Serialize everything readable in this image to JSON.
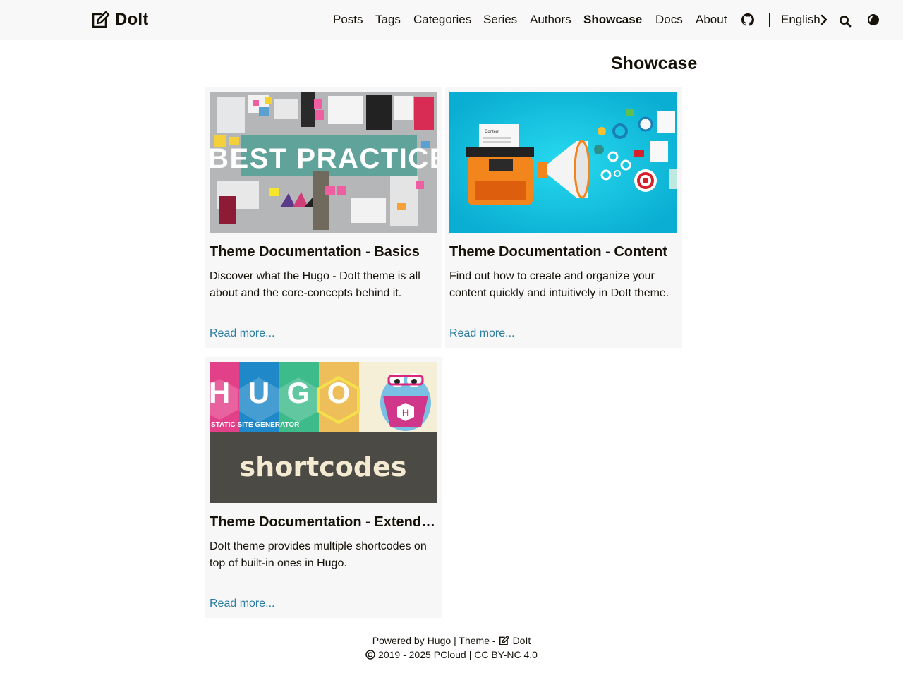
{
  "brand": {
    "name": "DoIt"
  },
  "nav": {
    "items": [
      {
        "label": "Posts"
      },
      {
        "label": "Tags"
      },
      {
        "label": "Categories"
      },
      {
        "label": "Series"
      },
      {
        "label": "Authors"
      },
      {
        "label": "Showcase",
        "active": true
      },
      {
        "label": "Docs"
      },
      {
        "label": "About"
      }
    ],
    "language": "English",
    "icons": [
      "github-icon",
      "chevron-right-icon",
      "search-icon",
      "theme-toggle-icon"
    ]
  },
  "page": {
    "title": "Showcase"
  },
  "cards": [
    {
      "title": "Theme Documentation - Basics",
      "summary": "Discover what the Hugo - DoIt theme is all about and the core-concepts behind it.",
      "read_more": "Read more...",
      "image_text": "BEST PRACTICE"
    },
    {
      "title": "Theme Documentation - Content",
      "summary": "Find out how to create and organize your content quickly and intuitively in DoIt theme.",
      "read_more": "Read more...",
      "image_text": "Content"
    },
    {
      "title": "Theme Documentation - Extended Shortcodes",
      "summary": "DoIt theme provides multiple shortcodes on top of built-in ones in Hugo.",
      "read_more": "Read more...",
      "image_text": {
        "letters": [
          "H",
          "U",
          "G",
          "O"
        ],
        "tagline": "STATIC SITE GENERATOR",
        "badge": "H",
        "word": "shortcodes"
      }
    }
  ],
  "footer": {
    "powered_prefix": "Powered by",
    "hugo": "Hugo",
    "theme_prefix": "| Theme -",
    "theme_name": "DoIt",
    "copyright_years": "2019 - 2025",
    "author": "PCloud",
    "license": "| CC BY-NC 4.0"
  },
  "colors": {
    "header_bg": "#f8f8f8",
    "card_bg": "#f7f7f7",
    "link": "#2a7ca4",
    "text": "#161209"
  }
}
